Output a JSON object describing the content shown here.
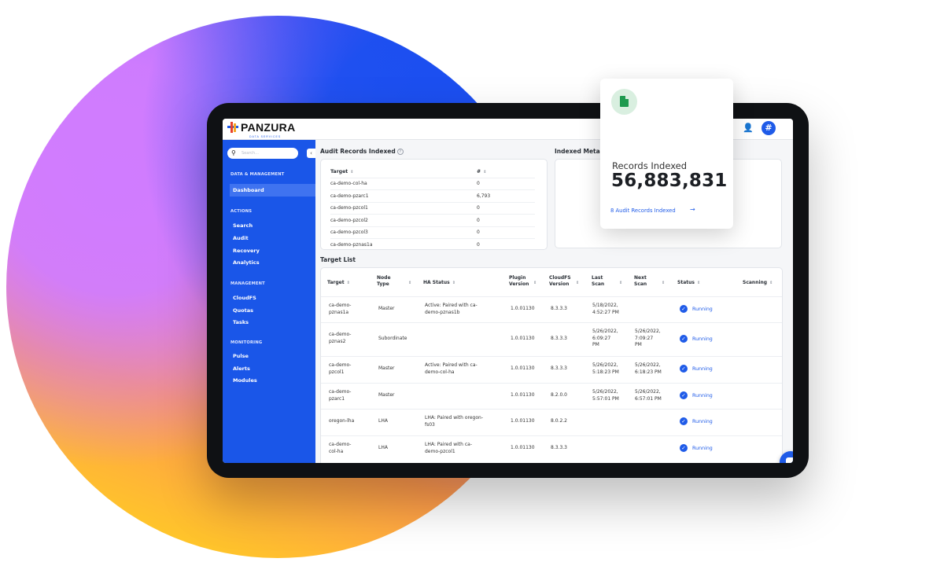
{
  "brand": {
    "name": "PANZURA",
    "sub": "DATA SERVICES",
    "accent": "#1a56e8"
  },
  "search": {
    "placeholder": "Search..."
  },
  "sidebar": {
    "sections": [
      {
        "title": "DATA & MANAGEMENT",
        "items": [
          "Dashboard"
        ]
      },
      {
        "title": "ACTIONS",
        "items": [
          "Search",
          "Audit",
          "Recovery",
          "Analytics"
        ]
      },
      {
        "title": "MANAGEMENT",
        "items": [
          "CloudFS",
          "Quotas",
          "Tasks"
        ]
      },
      {
        "title": "MONITORING",
        "items": [
          "Pulse",
          "Alerts",
          "Modules"
        ]
      }
    ],
    "active": "Dashboard"
  },
  "audit": {
    "title": "Audit Records Indexed",
    "col_target": "Target",
    "col_count": "#",
    "rows": [
      {
        "target": "ca-demo-col-ha",
        "count": "0"
      },
      {
        "target": "ca-demo-pzarc1",
        "count": "6,793"
      },
      {
        "target": "ca-demo-pzcol1",
        "count": "0"
      },
      {
        "target": "ca-demo-pzcol2",
        "count": "0"
      },
      {
        "target": "ca-demo-pzcol3",
        "count": "0"
      },
      {
        "target": "ca-demo-pznas1a",
        "count": "0"
      }
    ]
  },
  "indexed_meta": {
    "title": "Indexed Metad"
  },
  "target_list": {
    "title": "Target List",
    "headers": {
      "target": "Target",
      "node_type_1": "Node",
      "node_type_2": "Type",
      "ha_status": "HA Status",
      "plugin_1": "Plugin",
      "plugin_2": "Version",
      "cloudfs_1": "CloudFS",
      "cloudfs_2": "Version",
      "last_1": "Last",
      "last_2": "Scan",
      "next_1": "Next",
      "next_2": "Scan",
      "status": "Status",
      "scanning": "Scanning"
    },
    "rows": [
      {
        "target": [
          "ca-demo-",
          "pznas1a"
        ],
        "node": "Master",
        "ha": [
          "Active: Paired with ca-",
          "demo-pznas1b"
        ],
        "plugin": "1.0.01130",
        "cloudfs": "8.3.3.3",
        "last": [
          "5/18/2022,",
          "4:52:27 PM"
        ],
        "next": [],
        "status": "Running"
      },
      {
        "target": [
          "ca-demo-",
          "pznas2"
        ],
        "node": "Subordinate",
        "ha": [],
        "plugin": "1.0.01130",
        "cloudfs": "8.3.3.3",
        "last": [
          "5/26/2022,",
          "6:09:27",
          "PM"
        ],
        "next": [
          "5/26/2022,",
          "7:09:27",
          "PM"
        ],
        "status": "Running"
      },
      {
        "target": [
          "ca-demo-",
          "pzcol1"
        ],
        "node": "Master",
        "ha": [
          "Active: Paired with ca-",
          "demo-col-ha"
        ],
        "plugin": "1.0.01130",
        "cloudfs": "8.3.3.3",
        "last": [
          "5/26/2022,",
          "5:18:23 PM"
        ],
        "next": [
          "5/26/2022,",
          "6:18:23 PM"
        ],
        "status": "Running"
      },
      {
        "target": [
          "ca-demo-",
          "pzarc1"
        ],
        "node": "Master",
        "ha": [],
        "plugin": "1.0.01130",
        "cloudfs": "8.2.0.0",
        "last": [
          "5/26/2022,",
          "5:57:01 PM"
        ],
        "next": [
          "5/26/2022,",
          "6:57:01 PM"
        ],
        "status": "Running"
      },
      {
        "target": [
          "oregon-lha"
        ],
        "node": "LHA",
        "ha": [
          "LHA: Paired with oregon-",
          "fs03"
        ],
        "plugin": "1.0.01130",
        "cloudfs": "8.0.2.2",
        "last": [],
        "next": [],
        "status": "Running"
      },
      {
        "target": [
          "ca-demo-",
          "col-ha"
        ],
        "node": "LHA",
        "ha": [
          "LHA: Paired with ca-",
          "demo-pzcol1"
        ],
        "plugin": "1.0.01130",
        "cloudfs": "8.3.3.3",
        "last": [],
        "next": [],
        "status": "Running"
      }
    ]
  },
  "popup": {
    "label": "Records Indexed",
    "value": "56,883,831",
    "link": "8 Audit Records Indexed",
    "arrow": "→"
  },
  "icons": {
    "search": "search-icon",
    "collapse": "chevron-left-icon",
    "user": "user-settings-icon",
    "chat": "chat-icon",
    "doc": "document-icon",
    "check": "check-circle-icon",
    "sort": "sort-icon",
    "info": "info-icon"
  }
}
